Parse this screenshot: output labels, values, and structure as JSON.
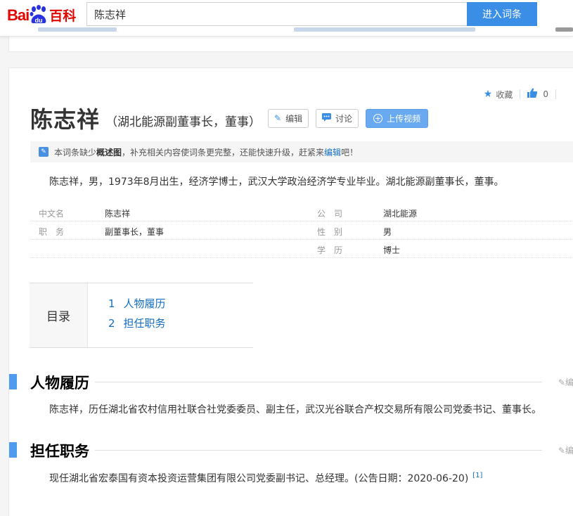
{
  "header": {
    "logo_bai": "Bai",
    "logo_du": "du",
    "logo_baike": "百科",
    "search_value": "陈志祥",
    "search_button": "进入词条"
  },
  "tools": {
    "collect_label": "收藏",
    "like_count": "0"
  },
  "entry": {
    "title": "陈志祥",
    "subtitle": "（湖北能源副董事长，董事）",
    "edit_label": "编辑",
    "discuss_label": "讨论",
    "upload_video_label": "上传视频"
  },
  "notice": {
    "text_before": "本词条缺少",
    "bold": "概述图",
    "text_middle": "，补充相关内容使词条更完整，还能快速升级，赶紧来",
    "link": "编辑",
    "text_after": "吧！"
  },
  "summary": "陈志祥，男，1973年8月出生，经济学博士，武汉大学政治经济学专业毕业。湖北能源副董事长，董事。",
  "infobox": {
    "rows": [
      {
        "k1": "中文名",
        "v1": "陈志祥",
        "k2": "公　司",
        "v2": "湖北能源"
      },
      {
        "k1": "职　务",
        "v1": "副董事长，董事",
        "k2": "性　别",
        "v2": "男"
      },
      {
        "k1": "",
        "v1": "",
        "k2": "学　历",
        "v2": "博士"
      }
    ]
  },
  "toc": {
    "label": "目录",
    "items": [
      {
        "num": "1",
        "label": "人物履历"
      },
      {
        "num": "2",
        "label": "担任职务"
      }
    ]
  },
  "sections": [
    {
      "title": "人物履历",
      "edit": "编",
      "text": "陈志祥，历任湖北省农村信用社联合社党委委员、副主任，武汉光谷联合产权交易所有限公司党委书记、董事长。"
    },
    {
      "title": "担任职务",
      "edit": "编",
      "text": "现任湖北省宏泰国有资本投资运营集团有限公司党委副书记、总经理。(公告日期：2020-06-20)",
      "ref": "[1]"
    }
  ],
  "colors": {
    "brand_red": "#e10601",
    "baidu_blue": "#2932e1",
    "accent_blue": "#3a8ee6",
    "link_blue": "#136ec2"
  }
}
